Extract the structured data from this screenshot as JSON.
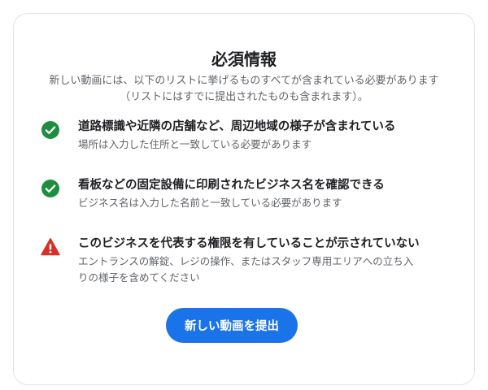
{
  "dialog": {
    "title": "必須情報",
    "subtitle_line1": "新しい動画には、以下のリストに挙げるものすべてが含まれている必要があります",
    "subtitle_line2": "（リストにはすでに提出されたものも含まれます）。"
  },
  "requirements": [
    {
      "status": "met",
      "icon": "check-circle-icon",
      "icon_color": "#1e8e3e",
      "heading": "道路標識や近隣の店舗など、周辺地域の様子が含まれている",
      "desc_line1": "場所は入力した住所と一致している必要があります",
      "desc_line2": ""
    },
    {
      "status": "met",
      "icon": "check-circle-icon",
      "icon_color": "#1e8e3e",
      "heading": "看板などの固定設備に印刷されたビジネス名を確認できる",
      "desc_line1": "ビジネス名は入力した名前と一致している必要があります",
      "desc_line2": ""
    },
    {
      "status": "not-met",
      "icon": "warning-icon",
      "icon_color": "#d93025",
      "heading": "このビジネスを代表する権限を有していることが示されていない",
      "desc_line1": "エントランスの解錠、レジの操作、またはスタッフ専用エリアへの立ち入",
      "desc_line2": "りの様子を含めてください"
    }
  ],
  "actions": {
    "submit_label": "新しい動画を提出",
    "submit_color": "#1a73e8"
  }
}
